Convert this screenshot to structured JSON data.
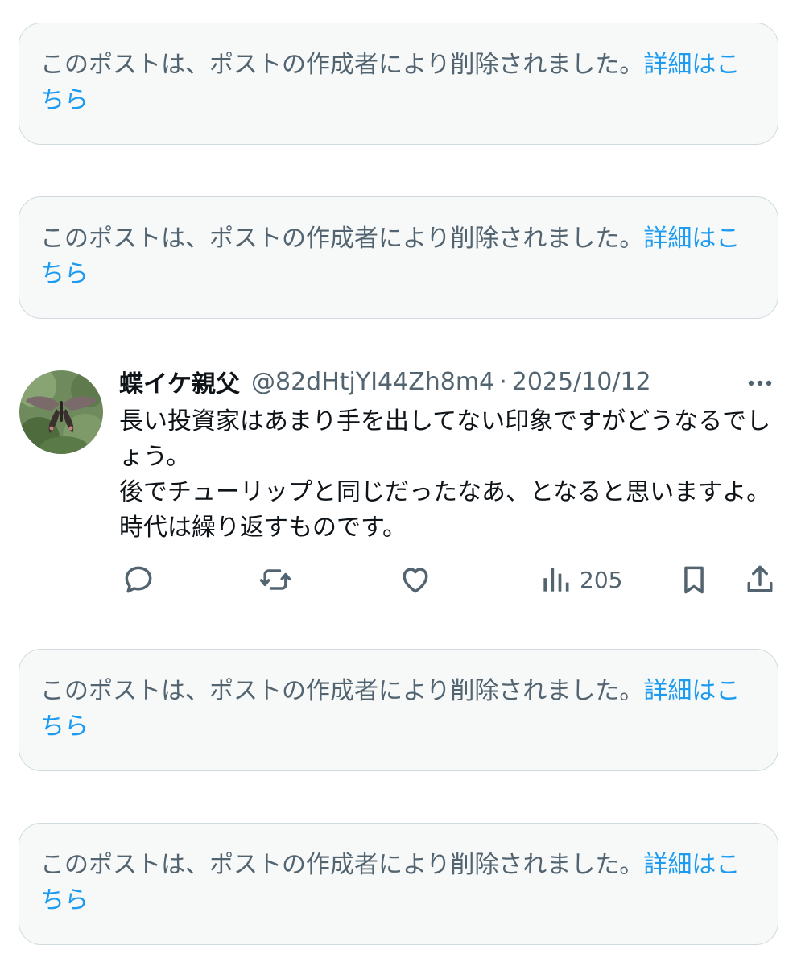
{
  "deleted_notice": {
    "text": "このポストは、ポストの作成者により削除されました。",
    "link": "詳細はこちら"
  },
  "post": {
    "author_name": "蝶イケ親父",
    "handle": "@82dHtjYI44Zh8m4",
    "separator": "·",
    "date": "2025/10/12",
    "body_line1": "長い投資家はあまり手を出してない印象ですがどうなるでしょう。",
    "body_line2": "後でチューリップと同じだったなあ、となると思いますよ。時代は繰り返すものです。",
    "views": "205"
  },
  "icons": {
    "more": "more-horizontal-icon",
    "reply": "reply-icon",
    "repost": "repost-icon",
    "like": "heart-icon",
    "views": "views-chart-icon",
    "bookmark": "bookmark-icon",
    "share": "share-icon"
  },
  "colors": {
    "link": "#1d9bf0",
    "secondary_text": "#536471",
    "box_background": "#f7f9f9",
    "box_border": "#cfd9de"
  }
}
